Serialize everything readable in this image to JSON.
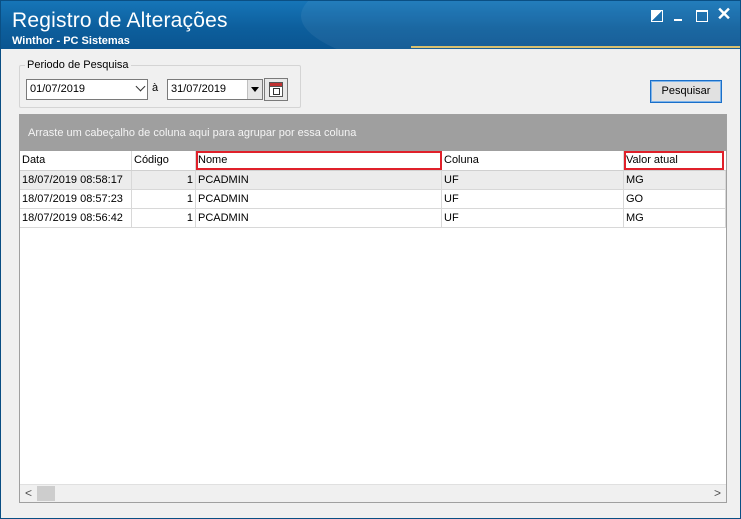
{
  "window": {
    "title": "Registro de Alterações",
    "subtitle": "Winthor - PC Sistemas",
    "controls": [
      "restore-icon",
      "minimize-icon",
      "maximize-icon",
      "close-icon"
    ]
  },
  "filter": {
    "group_label": "Periodo de Pesquisa",
    "start_date": "01/07/2019",
    "between_label": "à",
    "end_date": "31/07/2019",
    "search_button": "Pesquisar"
  },
  "grid": {
    "group_hint": "Arraste um cabeçalho de coluna aqui para agrupar por essa coluna",
    "columns": [
      "Data",
      "Código",
      "Nome",
      "Coluna",
      "Valor atual"
    ],
    "highlighted_columns": [
      "Nome",
      "Valor atual"
    ],
    "rows": [
      {
        "data": "18/07/2019 08:58:17",
        "codigo": "1",
        "nome": "PCADMIN",
        "coluna": "UF",
        "valor": "MG"
      },
      {
        "data": "18/07/2019 08:57:23",
        "codigo": "1",
        "nome": "PCADMIN",
        "coluna": "UF",
        "valor": "GO"
      },
      {
        "data": "18/07/2019 08:56:42",
        "codigo": "1",
        "nome": "PCADMIN",
        "coluna": "UF",
        "valor": "MG"
      }
    ],
    "scroll_left": "<",
    "scroll_right": ">"
  },
  "colors": {
    "titlebar": "#0d5f9d",
    "highlight": "#e0202a",
    "group_panel": "#9f9f9f"
  }
}
